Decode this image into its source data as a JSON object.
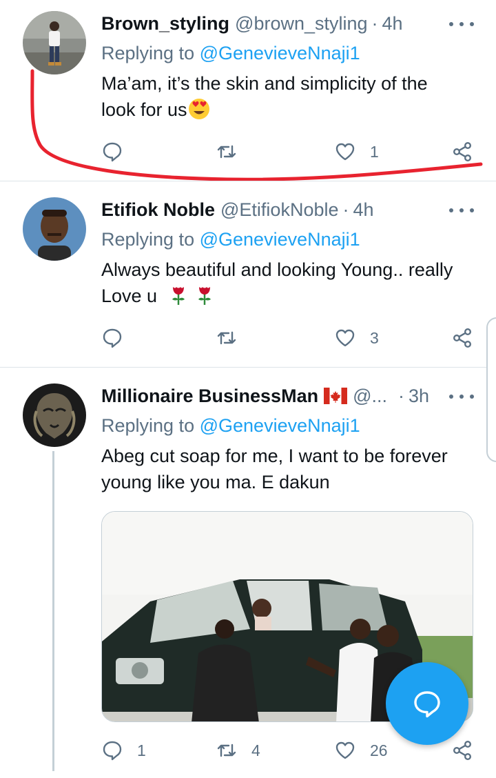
{
  "tweets": [
    {
      "name": "Brown_styling",
      "handle": "@brown_styling",
      "time": "4h",
      "replying_prefix": "Replying to",
      "replying_to": "@GenevieveNnaji1",
      "text_line1": "Ma’am, it’s the skin and simplicity of the",
      "text_line2": "look for us",
      "emoji": "heart-eyes-emoji",
      "replies": "",
      "retweets": "",
      "likes": "1"
    },
    {
      "name": "Etifiok Noble",
      "handle": "@EtifiokNoble",
      "time": "4h",
      "replying_prefix": "Replying to",
      "replying_to": "@GenevieveNnaji1",
      "text_line1": "Always beautiful and looking Young.. really",
      "text_line2": "Love u",
      "emoji": "rose-emoji",
      "replies": "",
      "retweets": "",
      "likes": "3"
    },
    {
      "name": "Millionaire BusinessMan",
      "handle": "@...",
      "time": "3h",
      "flag": "canada-flag",
      "replying_prefix": "Replying to",
      "replying_to": "@GenevieveNnaji1",
      "text_line1": "Abeg cut soap for me, I want to be forever",
      "text_line2": "young like you ma. E dakun",
      "media": "photo-car-scene",
      "replies": "1",
      "retweets": "4",
      "likes": "26"
    }
  ],
  "colors": {
    "accent": "#1da1f2",
    "secondary_text": "#5b7083",
    "primary_text": "#0f1419",
    "divider": "#dde3e8",
    "annotation": "#e8232f"
  },
  "icons": {
    "reply": "reply-icon",
    "retweet": "retweet-icon",
    "like": "heart-icon",
    "share": "share-icon",
    "more": "more-dots-icon",
    "compose": "compose-reply-icon"
  }
}
